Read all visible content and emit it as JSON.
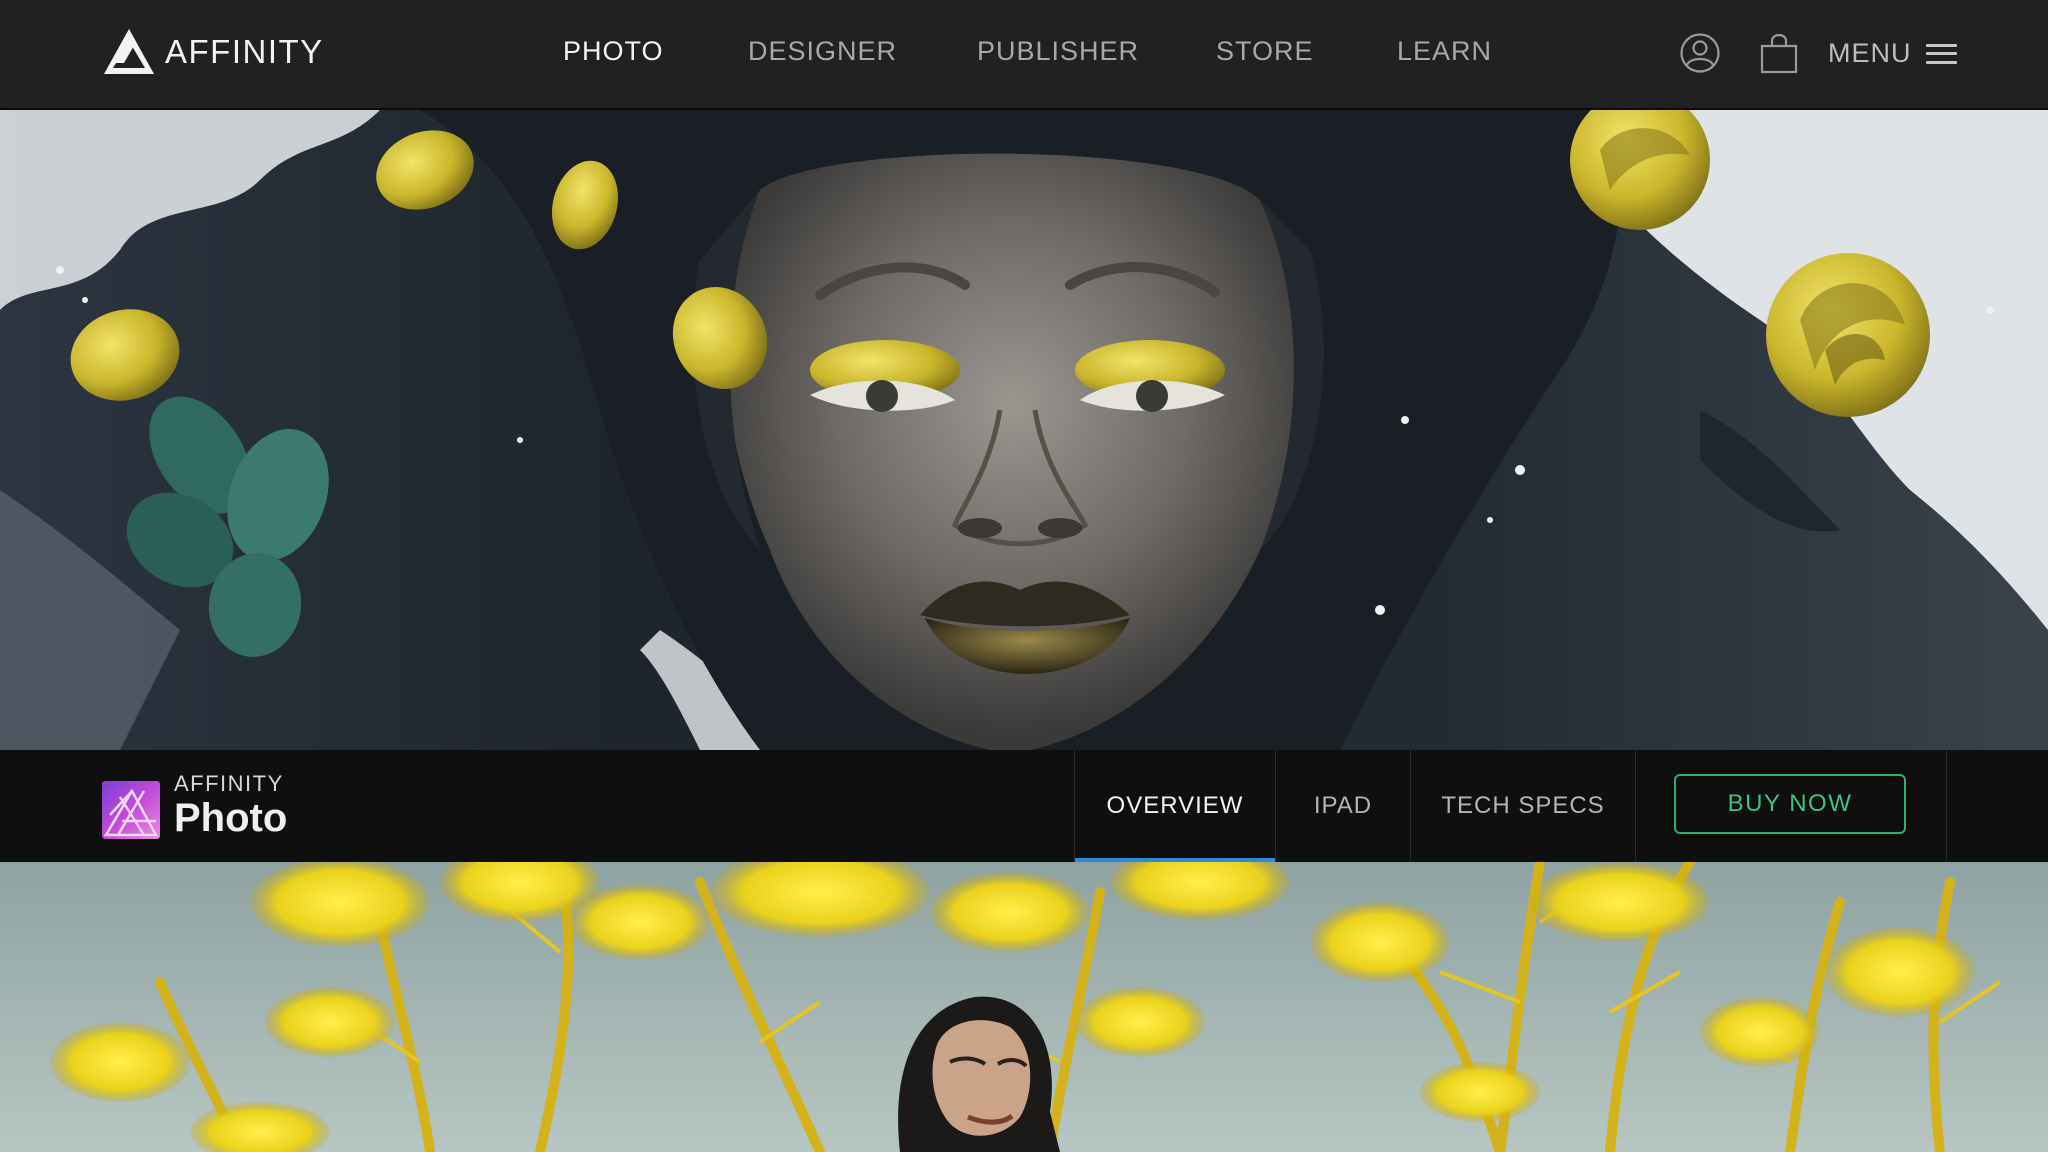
{
  "brand": {
    "name": "AFFINITY",
    "logo_icon": "affinity-triangle-logo"
  },
  "nav": {
    "items": [
      {
        "label": "PHOTO",
        "active": true
      },
      {
        "label": "DESIGNER",
        "active": false
      },
      {
        "label": "PUBLISHER",
        "active": false
      },
      {
        "label": "STORE",
        "active": false
      },
      {
        "label": "LEARN",
        "active": false
      }
    ],
    "account_icon": "user-circle-icon",
    "cart_icon": "shopping-bag-icon",
    "menu_label": "MENU",
    "menu_icon": "hamburger-icon"
  },
  "hero": {
    "description_icon": "hero-artwork"
  },
  "product_bar": {
    "brand": "AFFINITY",
    "product_name": "Photo",
    "tabs": [
      {
        "label": "OVERVIEW",
        "active": true
      },
      {
        "label": "IPAD",
        "active": false
      },
      {
        "label": "TECH SPECS",
        "active": false
      }
    ],
    "buy_label": "BUY NOW"
  },
  "colors": {
    "nav_bg": "#212122",
    "subnav_bg": "#0f0f10",
    "accent_blue": "#2e8bd8",
    "buy_green": "#2fb06f",
    "hero_yellow": "#d8c431"
  }
}
